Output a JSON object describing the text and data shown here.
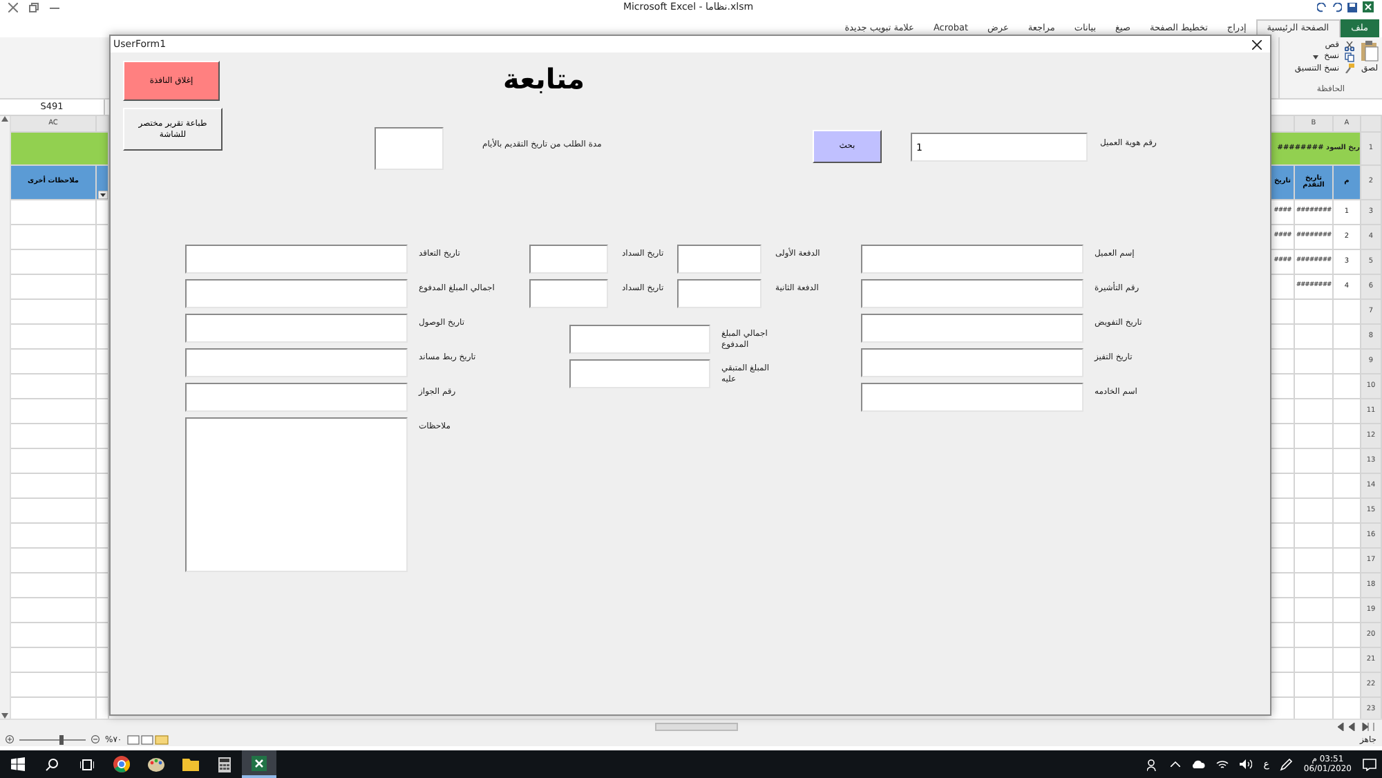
{
  "excel": {
    "title": "Microsoft Excel - نظاما.xlsm",
    "file_tab": "ملف",
    "tabs": [
      {
        "label": "الصفحة الرئيسية",
        "selected": true
      },
      {
        "label": "إدراج",
        "selected": false
      },
      {
        "label": "تخطيط الصفحة",
        "selected": false
      },
      {
        "label": "صيغ",
        "selected": false
      },
      {
        "label": "بيانات",
        "selected": false
      },
      {
        "label": "مراجعة",
        "selected": false
      },
      {
        "label": "عرض",
        "selected": false
      },
      {
        "label": "Acrobat",
        "selected": false
      },
      {
        "label": "علامة تبويب جديدة",
        "selected": false
      }
    ],
    "clipboard": {
      "paste": "لصق",
      "cut": "قص",
      "copy": "نسخ",
      "format_painter": "نسخ التنسيق",
      "group_label": "الحافظة"
    },
    "name_box": "S491"
  },
  "sheet": {
    "left_columns": [
      "AC"
    ],
    "right_columns": [
      "A",
      "B"
    ],
    "row_numbers": [
      "1",
      "2",
      "3",
      "4",
      "5",
      "6",
      "7",
      "8",
      "9",
      "10",
      "11",
      "12",
      "13",
      "14",
      "15",
      "16",
      "17",
      "18",
      "19",
      "20",
      "21",
      "22",
      "23"
    ],
    "banner": "ريخ السود ########",
    "left_header": "ملاحظات أخرى",
    "right_headers": [
      "م",
      "تاريخ التقدم",
      "تاريخ"
    ],
    "data_rows": [
      {
        "partial": "####",
        "date": "########",
        "serial": "1"
      },
      {
        "partial": "####",
        "date": "########",
        "serial": "2"
      },
      {
        "partial": "####",
        "date": "########",
        "serial": "3"
      },
      {
        "partial": "",
        "date": "########",
        "serial": "4"
      }
    ]
  },
  "form": {
    "title": "UserForm1",
    "heading": "متابعة",
    "close_button": "إغلاق النافذة",
    "print_button": "طباعة تقرير مختصر للشاشة",
    "duration": {
      "label": "مدة الطلب من تاريخ التقديم بالأيام"
    },
    "search_button": "بحث",
    "customer_id": {
      "label": "رقم هوية العميل",
      "value": "1"
    },
    "left_fields": [
      {
        "label": "تاريخ التعاقد"
      },
      {
        "label": "اجمالي المبلغ المدفوع"
      },
      {
        "label": "تاريخ الوصول"
      },
      {
        "label": "تاريخ ربط مساند"
      },
      {
        "label": "رقم الجواز"
      }
    ],
    "notes": {
      "label": "ملاحظات"
    },
    "payments": [
      {
        "label": "الدفعة الأولى",
        "date_label": "تاريخ السداد"
      },
      {
        "label": "الدفعة الثانية",
        "date_label": "تاريخ السداد"
      }
    ],
    "totals": [
      {
        "label": "اجمالي المبلغ المدفوع"
      },
      {
        "label": "المبلغ المتبقي عليه"
      }
    ],
    "right_fields": [
      {
        "label": "إسم العميل"
      },
      {
        "label": "رقم التأشيرة"
      },
      {
        "label": "تاريخ التفويض"
      },
      {
        "label": "تاريخ التفيز"
      },
      {
        "label": "اسم الخادمه"
      }
    ]
  },
  "status_bar": {
    "ready": "جاهز",
    "zoom": "%٧٠",
    "level": 0.63
  },
  "taskbar": {
    "time": "03:51 م",
    "date": "06/01/2020",
    "language": "ع"
  }
}
